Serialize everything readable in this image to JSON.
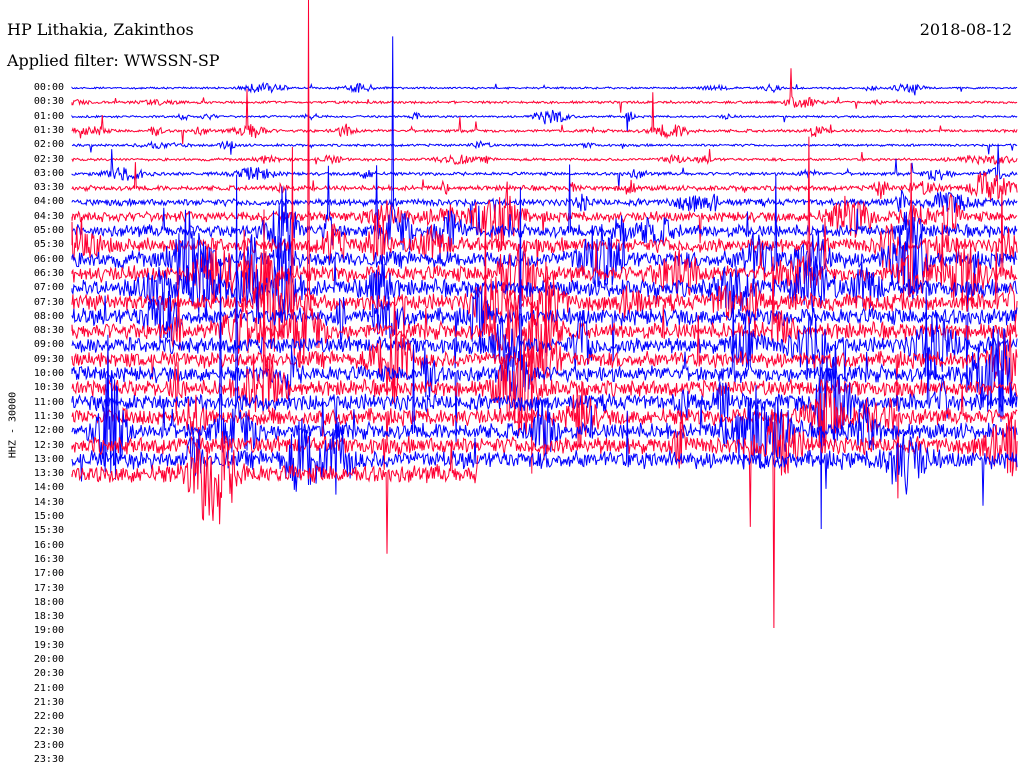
{
  "header": {
    "station": "HP Lithakia, Zakinthos",
    "filter": "Applied filter: WWSSN-SP",
    "date": "2018-08-12"
  },
  "chart_data": {
    "type": "line",
    "title": "HP Lithakia, Zakinthos",
    "subtitle": "Applied filter: WWSSN-SP",
    "date": "2018-08-12",
    "ylabel": "HHZ - 30000",
    "row_labels": [
      "00:00",
      "00:30",
      "01:00",
      "01:30",
      "02:00",
      "02:30",
      "03:00",
      "03:30",
      "04:00",
      "04:30",
      "05:00",
      "05:30",
      "06:00",
      "06:30",
      "07:00",
      "07:30",
      "08:00",
      "08:30",
      "09:00",
      "09:30",
      "10:00",
      "10:30",
      "11:00",
      "11:30",
      "12:00",
      "12:30",
      "13:00",
      "13:30",
      "14:00",
      "14:30",
      "15:00",
      "15:30",
      "16:00",
      "16:30",
      "17:00",
      "17:30",
      "18:00",
      "18:30",
      "19:00",
      "19:30",
      "20:00",
      "20:30",
      "21:00",
      "21:30",
      "22:00",
      "22:30",
      "23:00",
      "23:30"
    ],
    "series_colors": [
      "#0000ff",
      "#ff0033"
    ],
    "recorded_rows": 28,
    "last_row_fraction": 0.43,
    "row_noise_level": [
      0.35,
      0.45,
      0.4,
      0.55,
      0.45,
      0.5,
      0.6,
      0.9,
      1.3,
      1.9,
      2.3,
      2.7,
      3.0,
      3.0,
      3.1,
      3.1,
      3.2,
      3.1,
      3.0,
      3.0,
      3.0,
      3.0,
      3.1,
      3.1,
      3.0,
      3.2,
      3.3,
      3.4
    ]
  }
}
